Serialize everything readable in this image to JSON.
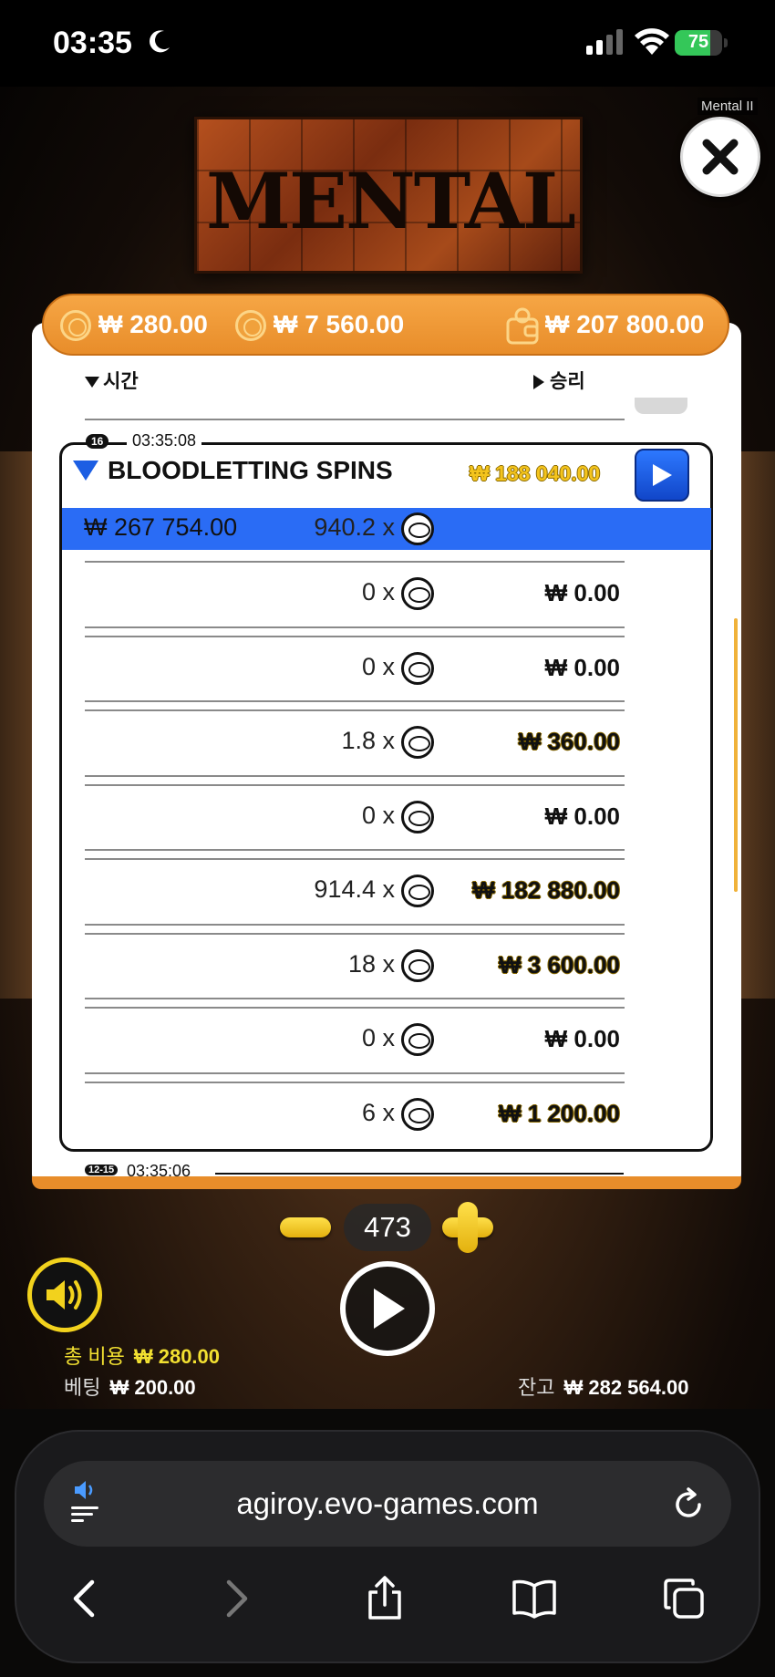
{
  "status_bar": {
    "time": "03:35",
    "battery": "75",
    "battery_level": 0.75
  },
  "game": {
    "logo_text": "MENTAL",
    "tag": "Mental II",
    "balances": {
      "bet_cost": "₩ 280.00",
      "feature_cost": "₩ 7 560.00",
      "wallet": "₩ 207 800.00"
    }
  },
  "history": {
    "col_time": "시간",
    "col_win": "승리",
    "group": {
      "badge": "16",
      "timestamp": "03:35:08",
      "title": "BLOODLETTING SPINS",
      "title_amount": "₩ 188 040.00",
      "total_win": "₩ 267 754.00",
      "total_multiplier": "940.2 x",
      "rows": [
        {
          "multiplier": "0 x",
          "win": "₩ 0.00",
          "gold": false
        },
        {
          "multiplier": "0 x",
          "win": "₩ 0.00",
          "gold": false
        },
        {
          "multiplier": "1.8 x",
          "win": "₩ 360.00",
          "gold": true
        },
        {
          "multiplier": "0 x",
          "win": "₩ 0.00",
          "gold": false
        },
        {
          "multiplier": "914.4 x",
          "win": "₩ 182 880.00",
          "gold": true
        },
        {
          "multiplier": "18 x",
          "win": "₩ 3 600.00",
          "gold": true
        },
        {
          "multiplier": "0 x",
          "win": "₩ 0.00",
          "gold": false
        },
        {
          "multiplier": "6 x",
          "win": "₩ 1 200.00",
          "gold": true
        }
      ]
    },
    "next_group": {
      "badge": "12-15",
      "timestamp": "03:35:06"
    }
  },
  "controls": {
    "bet_level": "473",
    "total_cost_label": "총 비용",
    "total_cost_value": "₩ 280.00",
    "bet_label": "베팅",
    "bet_value": "₩ 200.00",
    "balance_label": "잔고",
    "balance_value": "₩ 282 564.00"
  },
  "browser": {
    "url": "agiroy.evo-games.com"
  },
  "icons": {
    "moon": "moon-icon",
    "signal": "signal-icon",
    "wifi": "wifi-icon",
    "close": "close-icon",
    "coin": "coin-icon",
    "wallet": "wallet-icon",
    "sound": "speaker-icon",
    "spin": "play-icon",
    "reload": "reload-icon",
    "back": "chevron-left-icon",
    "forward": "chevron-right-icon",
    "share": "share-icon",
    "bookmarks": "book-icon",
    "tabs": "tabs-icon"
  },
  "colors": {
    "accent_orange": "#e88d2a",
    "highlight_blue": "#2a6cf5",
    "gold": "#f4c41d",
    "sound_yellow": "#f2d21d"
  }
}
